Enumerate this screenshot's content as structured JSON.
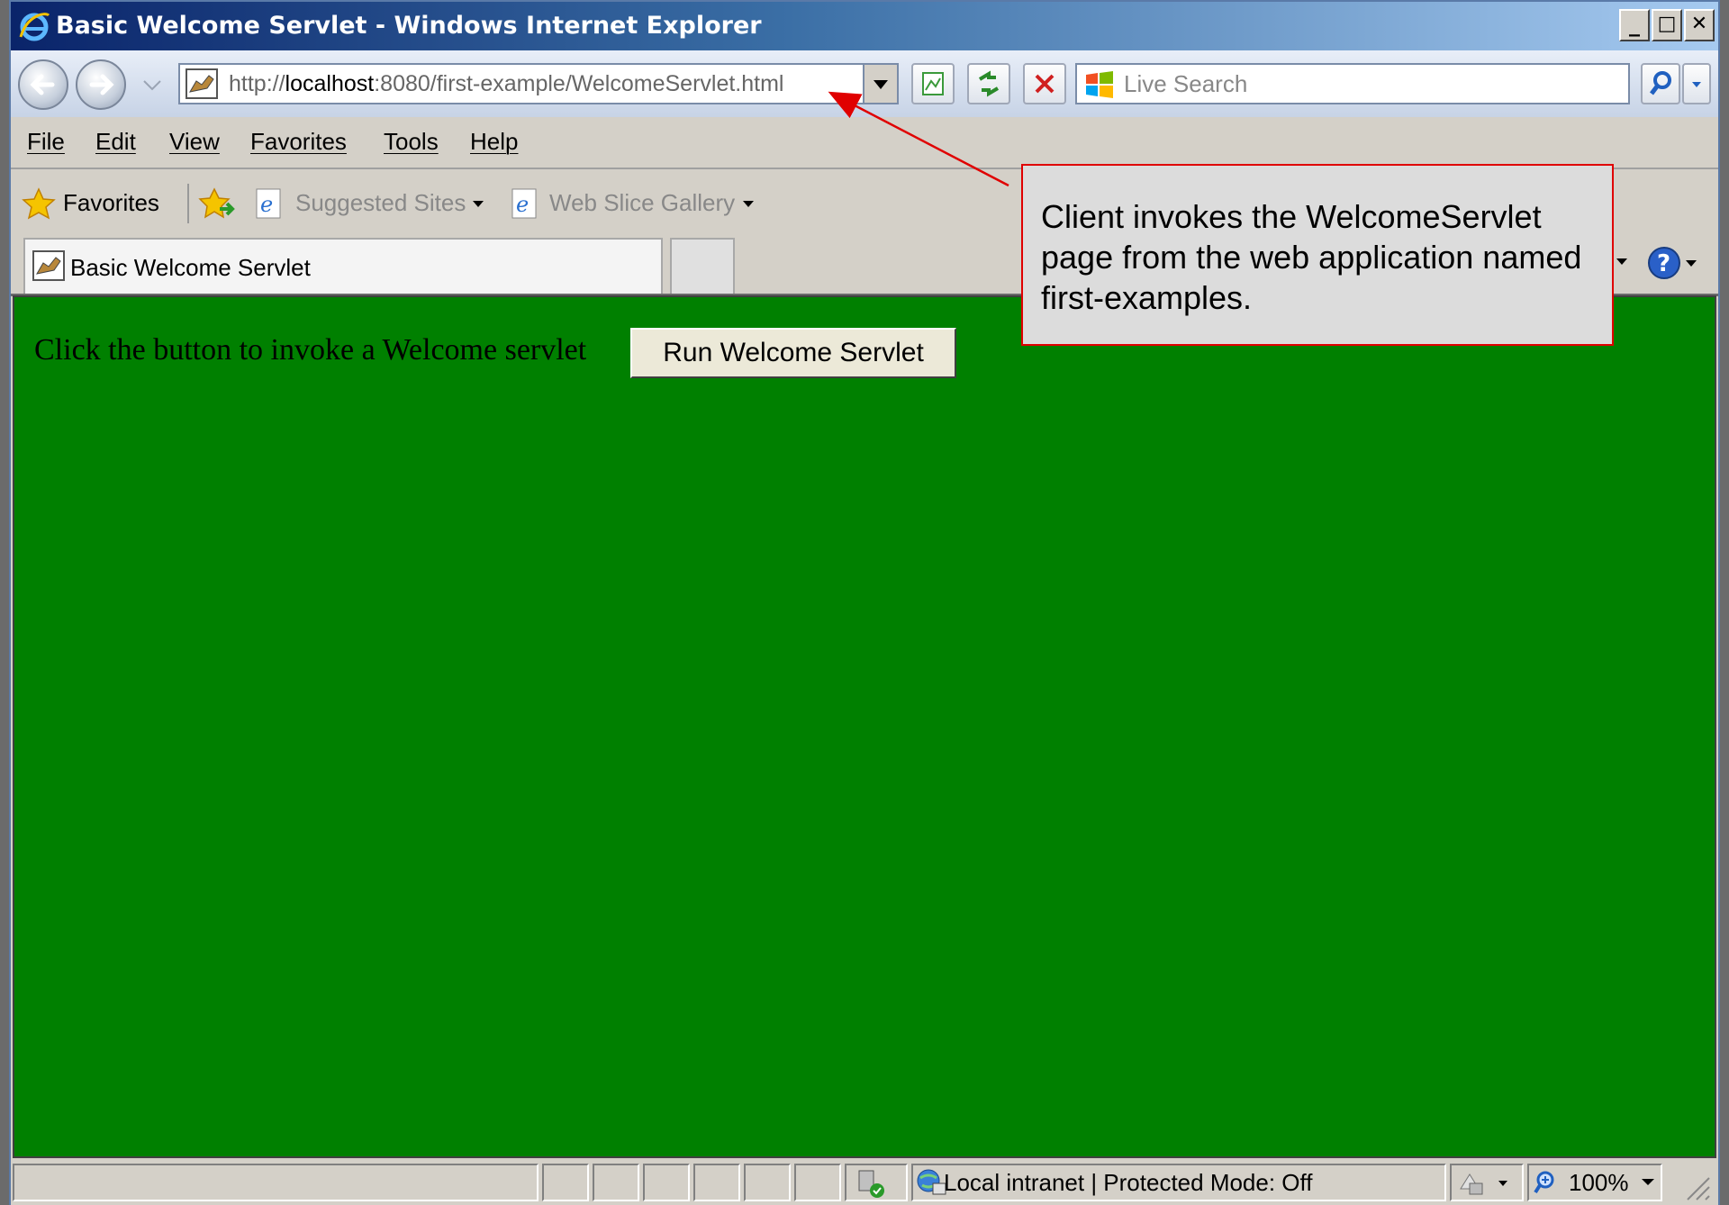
{
  "window": {
    "title": "Basic Welcome Servlet - Windows Internet Explorer",
    "minimize": "_",
    "maximize": "□",
    "close": "✕"
  },
  "navbar": {
    "url_prefix": "http://",
    "url_host": "localhost",
    "url_rest": ":8080/first-example/WelcomeServlet.html",
    "search_placeholder": "Live Search"
  },
  "menu": {
    "file": "File",
    "edit": "Edit",
    "view": "View",
    "favorites": "Favorites",
    "tools": "Tools",
    "help": "Help"
  },
  "favbar": {
    "favorites": "Favorites",
    "suggested_sites": "Suggested Sites",
    "web_slice_gallery": "Web Slice Gallery"
  },
  "tab": {
    "title": "Basic Welcome Servlet"
  },
  "content": {
    "prompt": "Click the button to invoke a Welcome servlet",
    "button": "Run Welcome Servlet",
    "background": "#008000"
  },
  "status": {
    "zone": "Local intranet | Protected Mode: Off",
    "zoom": "100%"
  },
  "callout": {
    "text": "Client invokes the WelcomeServlet page from the web application named first-examples.",
    "border_color": "#e00000"
  }
}
